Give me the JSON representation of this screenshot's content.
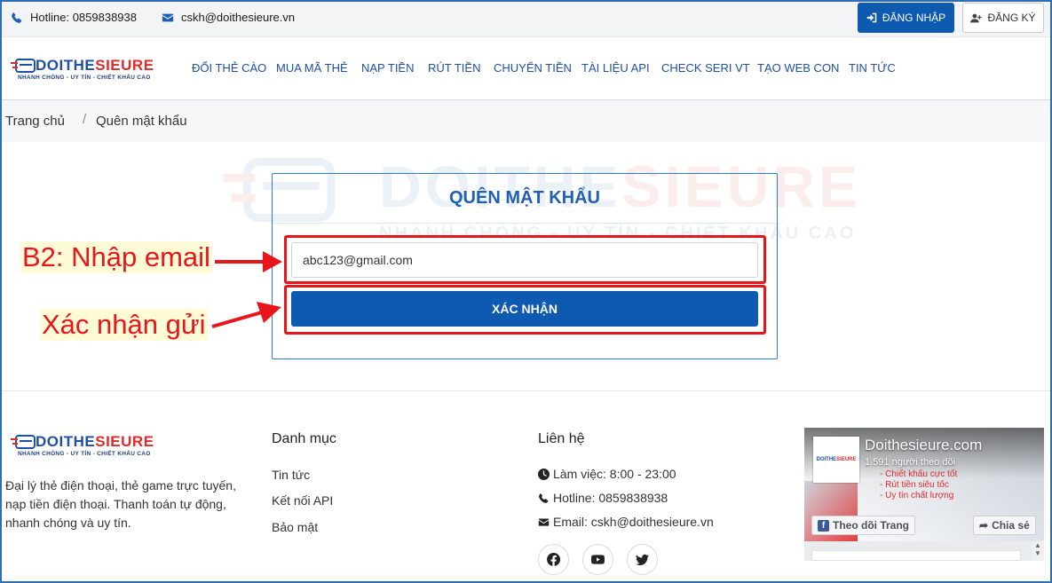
{
  "topbar": {
    "hotline": "Hotline: 0859838938",
    "email": "cskh@doithesieure.vn",
    "login_label": "ĐĂNG NHẬP",
    "register_label": "ĐĂNG KÝ"
  },
  "brand": {
    "name_part1": "DOITHE",
    "name_part2": "SIEURE",
    "tagline": "NHANH CHÓNG - UY TÍN - CHIẾT KHẤU CAO",
    "blue": "#1f4fa6",
    "red": "#e02a2a"
  },
  "nav": {
    "items": [
      {
        "label": "ĐỔI THẺ CÀO"
      },
      {
        "label": "MUA MÃ THẺ"
      },
      {
        "label": "NẠP TIỀN"
      },
      {
        "label": "RÚT TIỀN"
      },
      {
        "label": "CHUYỂN TIỀN"
      },
      {
        "label": "TÀI LIỆU API"
      },
      {
        "label": "CHECK SERI VT"
      },
      {
        "label": "TẠO WEB CON"
      },
      {
        "label": "TIN TỨC"
      }
    ]
  },
  "breadcrumb": {
    "home": "Trang chủ",
    "separator": "/",
    "current": "Quên mật khẩu"
  },
  "form": {
    "title": "QUÊN MẬT KHẨU",
    "email_value": "abc123@gmail.com",
    "submit_label": "XÁC NHẬN",
    "accent": "#0d5ab0"
  },
  "annotations": {
    "step_email": "B2: Nhập email",
    "step_submit": "Xác nhận gửi",
    "color": "#e8161b"
  },
  "footer": {
    "description": "Đại lý thẻ điện thoại, thẻ game trực tuyến, nạp tiền điện thoại. Thanh toán tự động, nhanh chóng và uy tín.",
    "menu_heading": "Danh mục",
    "menu_links": [
      {
        "label": "Tin tức"
      },
      {
        "label": "Kết nối API"
      },
      {
        "label": "Bảo mật"
      }
    ],
    "contact_heading": "Liên hệ",
    "contact": {
      "hours": "Làm việc: 8:00 - 23:00",
      "hotline": "Hotline: 0859838938",
      "email": "Email: cskh@doithesieure.vn"
    },
    "social": [
      "facebook-icon",
      "youtube-icon",
      "twitter-icon"
    ]
  },
  "fb_widget": {
    "page_name": "Doithesieure.com",
    "followers": "1.591 người theo dõi",
    "perks": [
      "- Chiết khấu cực tốt",
      "- Rút tiền siêu tốc",
      "- Uy tín chất lượng"
    ],
    "follow_label": "Theo dõi Trang",
    "share_label": "Chia sẻ"
  }
}
